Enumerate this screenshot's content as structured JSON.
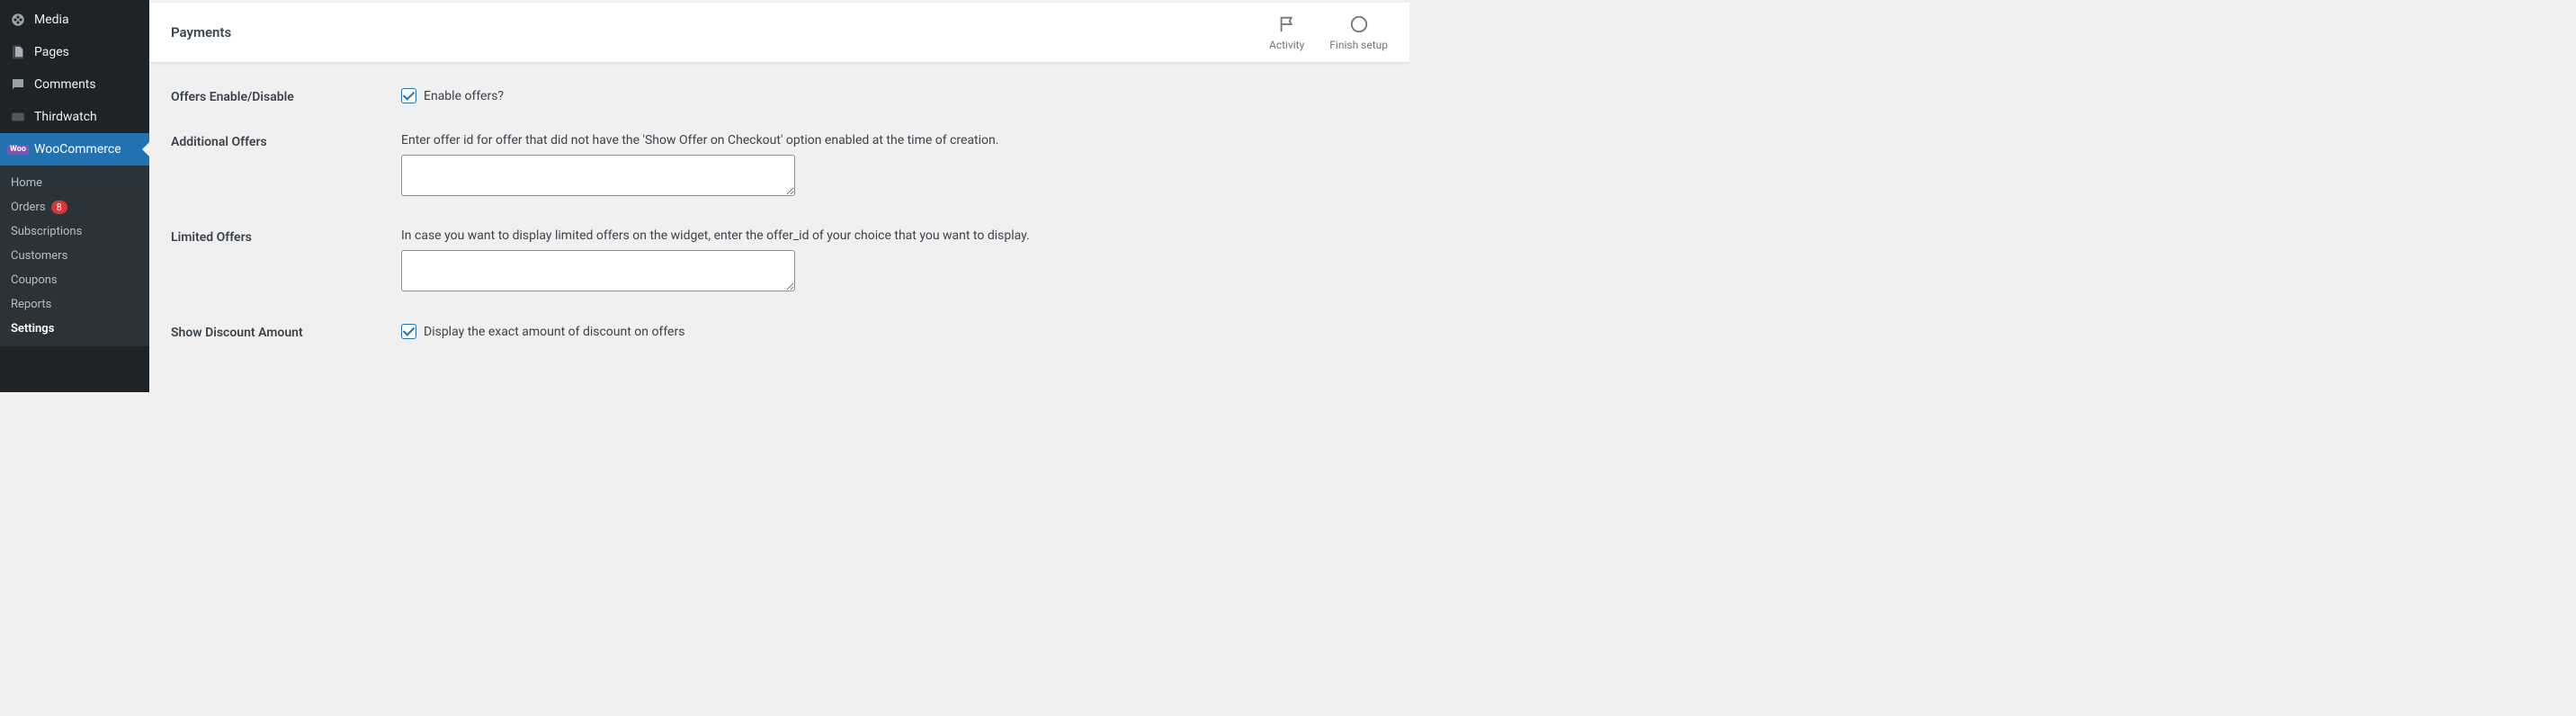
{
  "sidebar": {
    "items": [
      {
        "label": "Media"
      },
      {
        "label": "Pages"
      },
      {
        "label": "Comments"
      },
      {
        "label": "Thirdwatch"
      },
      {
        "label": "WooCommerce"
      }
    ],
    "submenu": [
      {
        "label": "Home"
      },
      {
        "label": "Orders",
        "badge": "8"
      },
      {
        "label": "Subscriptions"
      },
      {
        "label": "Customers"
      },
      {
        "label": "Coupons"
      },
      {
        "label": "Reports"
      },
      {
        "label": "Settings"
      }
    ]
  },
  "topbar": {
    "title": "Payments",
    "activity": "Activity",
    "finish": "Finish setup"
  },
  "form": {
    "offers_enable": {
      "label": "Offers Enable/Disable",
      "checkbox_label": "Enable offers?"
    },
    "additional": {
      "label": "Additional Offers",
      "desc": "Enter offer id for offer that did not have the 'Show Offer on Checkout' option enabled at the time of creation.",
      "value": ""
    },
    "limited": {
      "label": "Limited Offers",
      "desc": "In case you want to display limited offers on the widget, enter the offer_id of your choice that you want to display.",
      "value": ""
    },
    "discount": {
      "label": "Show Discount Amount",
      "checkbox_label": "Display the exact amount of discount on offers"
    }
  }
}
